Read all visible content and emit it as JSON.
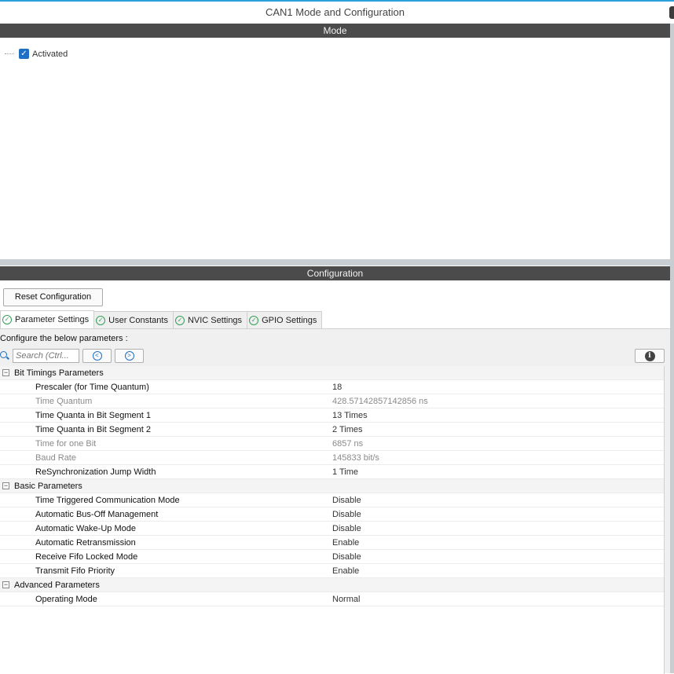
{
  "window": {
    "title": "CAN1 Mode and Configuration"
  },
  "mode": {
    "header": "Mode",
    "activated_label": "Activated",
    "activated_checked": true
  },
  "configuration": {
    "header": "Configuration",
    "reset_label": "Reset Configuration",
    "tabs": [
      {
        "label": "Parameter Settings",
        "active": true
      },
      {
        "label": "User Constants",
        "active": false
      },
      {
        "label": "NVIC Settings",
        "active": false
      },
      {
        "label": "GPIO Settings",
        "active": false
      }
    ],
    "configure_label": "Configure the below parameters :",
    "search_placeholder": "Search (Ctrl...",
    "groups": [
      {
        "name": "Bit Timings Parameters",
        "params": [
          {
            "name": "Prescaler (for Time Quantum)",
            "value": "18",
            "editable": true
          },
          {
            "name": "Time Quantum",
            "value": "428.57142857142856 ns",
            "editable": false
          },
          {
            "name": "Time Quanta in Bit Segment 1",
            "value": "13 Times",
            "editable": true
          },
          {
            "name": "Time Quanta in Bit Segment 2",
            "value": "2 Times",
            "editable": true
          },
          {
            "name": "Time for one Bit",
            "value": "6857 ns",
            "editable": false
          },
          {
            "name": "Baud Rate",
            "value": "145833 bit/s",
            "editable": false
          },
          {
            "name": "ReSynchronization Jump Width",
            "value": "1 Time",
            "editable": true
          }
        ]
      },
      {
        "name": "Basic Parameters",
        "params": [
          {
            "name": "Time Triggered Communication Mode",
            "value": "Disable",
            "editable": true
          },
          {
            "name": "Automatic Bus-Off Management",
            "value": "Disable",
            "editable": true
          },
          {
            "name": "Automatic Wake-Up Mode",
            "value": "Disable",
            "editable": true
          },
          {
            "name": "Automatic Retransmission",
            "value": "Enable",
            "editable": true
          },
          {
            "name": "Receive Fifo Locked Mode",
            "value": "Disable",
            "editable": true
          },
          {
            "name": "Transmit Fifo Priority",
            "value": "Enable",
            "editable": true
          }
        ]
      },
      {
        "name": "Advanced Parameters",
        "params": [
          {
            "name": "Operating Mode",
            "value": "Normal",
            "editable": true
          }
        ]
      }
    ]
  },
  "icons": {
    "checkbox": "checkbox-checked-icon",
    "tab_status": "check-circle-icon",
    "search": "search-icon",
    "prev": "chevron-left-circle-icon",
    "next": "chevron-right-circle-icon",
    "info": "info-icon",
    "collapse": "collapse-minus-icon"
  },
  "colors": {
    "accent": "#1f6fc5",
    "tab_check": "#33a05a",
    "header_bar": "#4b4b4b"
  }
}
